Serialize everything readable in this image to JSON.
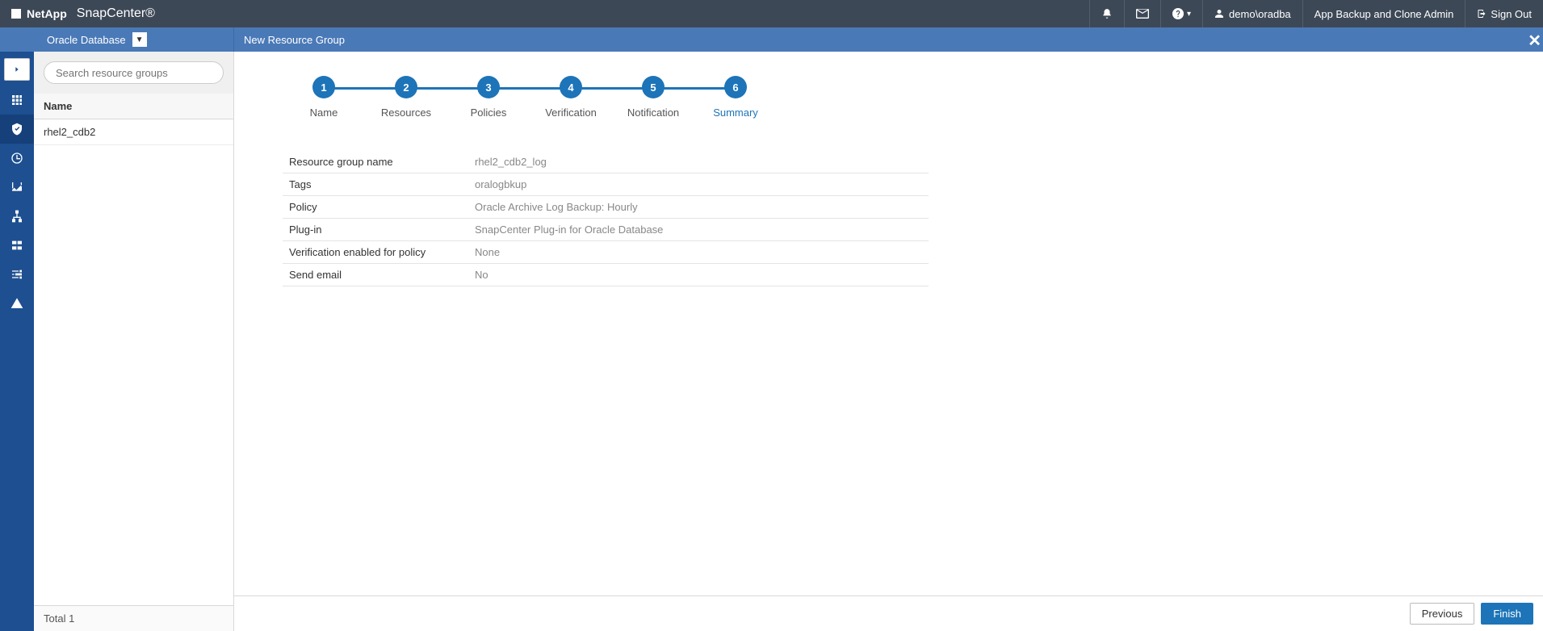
{
  "header": {
    "brand": "NetApp",
    "product": "SnapCenter®",
    "user": "demo\\oradba",
    "role": "App Backup and Clone Admin",
    "signout": "Sign Out"
  },
  "subheader": {
    "context": "Oracle Database",
    "title": "New Resource Group"
  },
  "sidebar": {
    "search_placeholder": "Search resource groups",
    "column_header": "Name",
    "items": [
      "rhel2_cdb2"
    ],
    "footer_label": "Total",
    "footer_count": "1"
  },
  "wizard": {
    "steps": [
      {
        "num": "1",
        "label": "Name"
      },
      {
        "num": "2",
        "label": "Resources"
      },
      {
        "num": "3",
        "label": "Policies"
      },
      {
        "num": "4",
        "label": "Verification"
      },
      {
        "num": "5",
        "label": "Notification"
      },
      {
        "num": "6",
        "label": "Summary"
      }
    ],
    "active_step_index": 5,
    "summary": [
      {
        "key": "Resource group name",
        "value": "rhel2_cdb2_log"
      },
      {
        "key": "Tags",
        "value": "oralogbkup"
      },
      {
        "key": "Policy",
        "value": "Oracle Archive Log Backup: Hourly"
      },
      {
        "key": "Plug-in",
        "value": "SnapCenter Plug-in for Oracle Database"
      },
      {
        "key": "Verification enabled for policy",
        "value": "None"
      },
      {
        "key": "Send email",
        "value": "No"
      }
    ]
  },
  "buttons": {
    "previous": "Previous",
    "finish": "Finish"
  }
}
